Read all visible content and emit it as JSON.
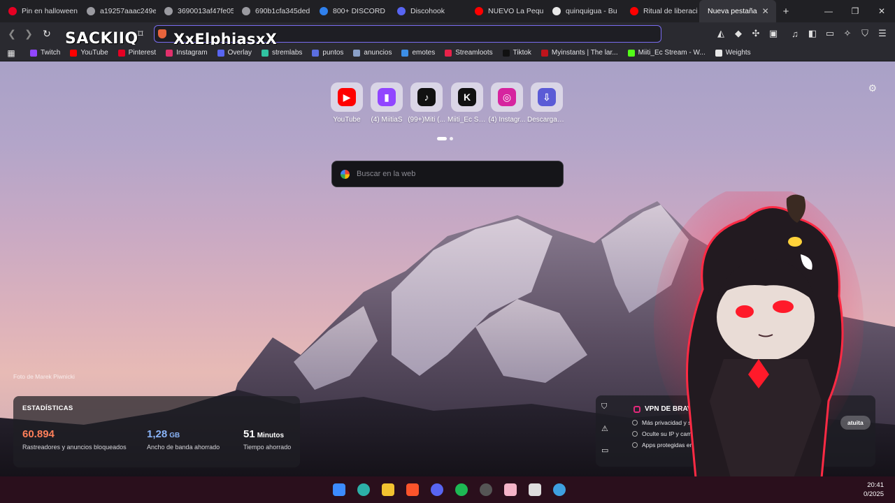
{
  "tabs": [
    {
      "label": "Pin en halloween",
      "color": "#e60023",
      "width": 112
    },
    {
      "label": "a19257aaac249e",
      "color": "#9a9aa0",
      "width": 111
    },
    {
      "label": "3690013af47fe05",
      "color": "#9a9aa0",
      "width": 111
    },
    {
      "label": "690b1cfa345ded",
      "color": "#9a9aa0",
      "width": 111
    },
    {
      "label": "800+ DISCORD",
      "color": "#2f80ed",
      "width": 111
    },
    {
      "label": "Discohook",
      "color": "#5865f2",
      "width": 111
    },
    {
      "label": "NUEVO La Pequ",
      "color": "#ff0000",
      "width": 111
    },
    {
      "label": "quinquigua - Bu",
      "color": "#e8e8e8",
      "width": 111
    },
    {
      "label": "Ritual de liberaci",
      "color": "#ff0000",
      "width": 111
    },
    {
      "label": "Nueva pestaña",
      "color": "",
      "width": 110,
      "active": true
    }
  ],
  "overlay_name": "SACKIIQ",
  "address_text": "XxElphiasxX",
  "bookmarks": [
    {
      "label": "Twitch",
      "color": "#9146ff"
    },
    {
      "label": "YouTube",
      "color": "#ff0000"
    },
    {
      "label": "Pinterest",
      "color": "#e60023"
    },
    {
      "label": "Instagram",
      "color": "#e1306c"
    },
    {
      "label": "Overlay",
      "color": "#5865f2"
    },
    {
      "label": "stremlabs",
      "color": "#31c3a2"
    },
    {
      "label": "puntos",
      "color": "#5b6ee1"
    },
    {
      "label": "anuncios",
      "color": "#8aa0c8"
    },
    {
      "label": "emotes",
      "color": "#3c8ee6"
    },
    {
      "label": "Streamloots",
      "color": "#e8224a"
    },
    {
      "label": "Tiktok",
      "color": "#111111"
    },
    {
      "label": "Myinstants | The lar...",
      "color": "#c0141c"
    },
    {
      "label": "Miiti_Ec Stream - W...",
      "color": "#53fc18"
    },
    {
      "label": "Weights",
      "color": "#e8e8e8"
    }
  ],
  "top_sites": [
    {
      "label": "YouTube",
      "color": "#ff0000",
      "glyph": "▶"
    },
    {
      "label": "(4) MiitiaS",
      "color": "#9146ff",
      "glyph": "▮"
    },
    {
      "label": "(99+)Miti (...",
      "color": "#111111",
      "glyph": "♪"
    },
    {
      "label": "Miiti_Ec Str...",
      "color": "#111111",
      "glyph": "K"
    },
    {
      "label": "(4) Instagr...",
      "color": "#d6249f",
      "glyph": "◎"
    },
    {
      "label": "Descargar ...",
      "color": "#5b5bd6",
      "glyph": "⇩"
    }
  ],
  "search_placeholder": "Buscar en la web",
  "photo_credit": "Foto de Marek Piwnicki",
  "stats": {
    "title": "ESTADÍSTICAS",
    "trackers_value": "60.894",
    "trackers_label": "Rastreadores y anuncios bloqueados",
    "bandwidth_value": "1,28",
    "bandwidth_unit": "GB",
    "bandwidth_label": "Ancho de banda ahorrado",
    "time_value": "51",
    "time_unit": "Minutos",
    "time_label": "Tiempo ahorrado"
  },
  "vpn": {
    "title": "VPN DE BRAVE",
    "items": [
      "Más privacidad y segu",
      "Oculte su IP y cambie",
      "Apps protegidas en"
    ],
    "cta": "atuita"
  },
  "clock": {
    "time": "20:41",
    "date": "0/2025"
  }
}
